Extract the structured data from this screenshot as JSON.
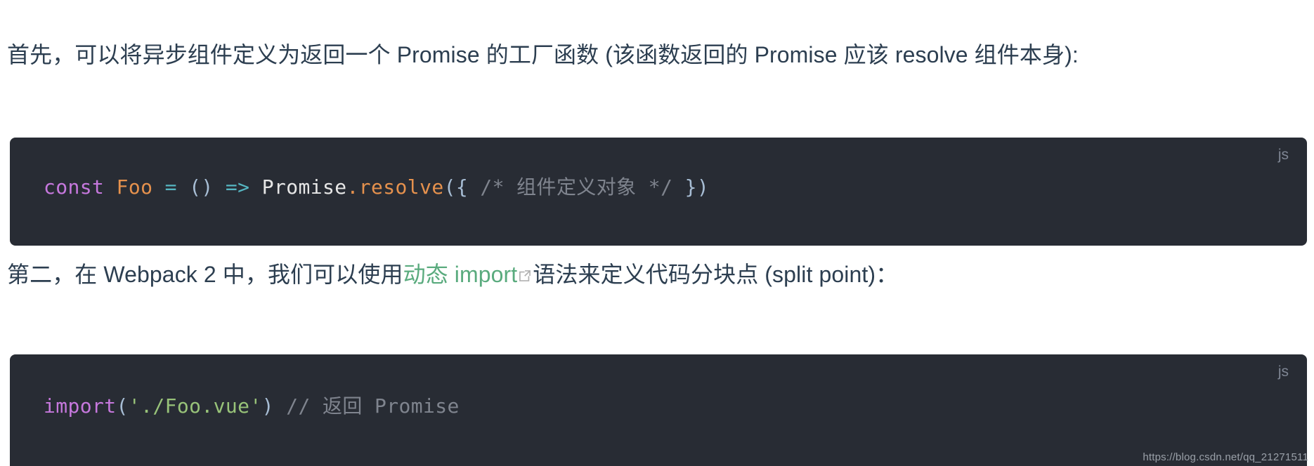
{
  "colors": {
    "page_background": "#ffffff",
    "body_text": "#2c3e50",
    "link_green": "#5aab7e",
    "code_background": "#282c34",
    "code_lang_label": "#7f8694",
    "comment_gray": "#7f848e",
    "keyword_purple": "#c678dd",
    "variable_orange": "#e5914d",
    "operator_cyan": "#56b6c2",
    "string_green": "#98c379",
    "paren_blue": "#a7bdd4",
    "watermark": "#9aa0a8"
  },
  "paragraph_1": {
    "part_1": "首先，可以将异步组件定义为返回一个 Promise 的工厂函数 (该函数返回的 Promise 应该 resolve 组件本身):"
  },
  "paragraph_2": {
    "before_link": "第二，在 Webpack 2 中，我们可以使用",
    "link_text": "动态 import",
    "link_icon": "external-link-icon",
    "after_link": "语法来定义代码分块点 (split point)："
  },
  "code_block_1": {
    "lang_label": "js",
    "tokens": [
      {
        "text": "const",
        "cls": "t-kw"
      },
      {
        "text": " ",
        "cls": "t-plain"
      },
      {
        "text": "Foo",
        "cls": "t-var"
      },
      {
        "text": " ",
        "cls": "t-plain"
      },
      {
        "text": "=",
        "cls": "t-op"
      },
      {
        "text": " ",
        "cls": "t-plain"
      },
      {
        "text": "()",
        "cls": "t-paren"
      },
      {
        "text": " ",
        "cls": "t-plain"
      },
      {
        "text": "=>",
        "cls": "t-op"
      },
      {
        "text": " ",
        "cls": "t-plain"
      },
      {
        "text": "Promise",
        "cls": "t-obj"
      },
      {
        "text": ".",
        "cls": "t-dot"
      },
      {
        "text": "resolve",
        "cls": "t-fn"
      },
      {
        "text": "({",
        "cls": "t-paren"
      },
      {
        "text": " ",
        "cls": "t-plain"
      },
      {
        "text": "/* 组件定义对象 */",
        "cls": "t-comment"
      },
      {
        "text": " ",
        "cls": "t-plain"
      },
      {
        "text": "})",
        "cls": "t-paren"
      }
    ],
    "plain_text": "const Foo = () => Promise.resolve({ /* 组件定义对象 */ })"
  },
  "code_block_2": {
    "lang_label": "js",
    "tokens": [
      {
        "text": "import",
        "cls": "t-kw"
      },
      {
        "text": "(",
        "cls": "t-paren"
      },
      {
        "text": "'./Foo.vue'",
        "cls": "t-string"
      },
      {
        "text": ")",
        "cls": "t-paren"
      },
      {
        "text": " ",
        "cls": "t-plain"
      },
      {
        "text": "// 返回 Promise",
        "cls": "t-comment"
      }
    ],
    "plain_text": "import('./Foo.vue') // 返回 Promise"
  },
  "watermark": {
    "text": "https://blog.csdn.net/qq_21271511"
  }
}
